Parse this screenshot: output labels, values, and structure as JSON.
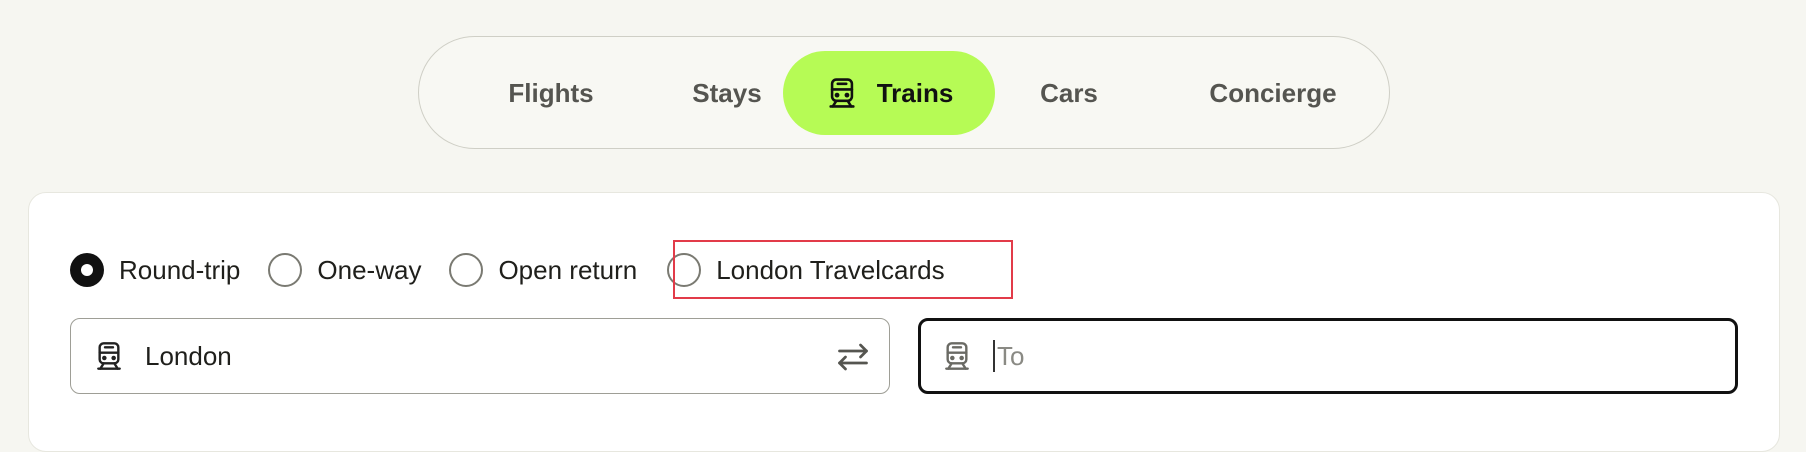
{
  "tabs": [
    {
      "label": "Flights",
      "active": false
    },
    {
      "label": "Stays",
      "active": false
    },
    {
      "label": "Trains",
      "active": true,
      "icon": "train-icon"
    },
    {
      "label": "Cars",
      "active": false
    },
    {
      "label": "Concierge",
      "active": false
    }
  ],
  "trip_types": [
    {
      "label": "Round-trip",
      "checked": true
    },
    {
      "label": "One-way",
      "checked": false
    },
    {
      "label": "Open return",
      "checked": false
    },
    {
      "label": "London Travelcards",
      "checked": false,
      "highlighted": true
    }
  ],
  "from_field": {
    "value": "London",
    "icon": "train-icon",
    "swap_icon": "swap-arrows-icon"
  },
  "to_field": {
    "placeholder": "To",
    "value": "",
    "icon": "train-icon"
  },
  "colors": {
    "accent": "#b6fb55",
    "background": "#f6f6f1",
    "highlight": "#e23b49"
  }
}
